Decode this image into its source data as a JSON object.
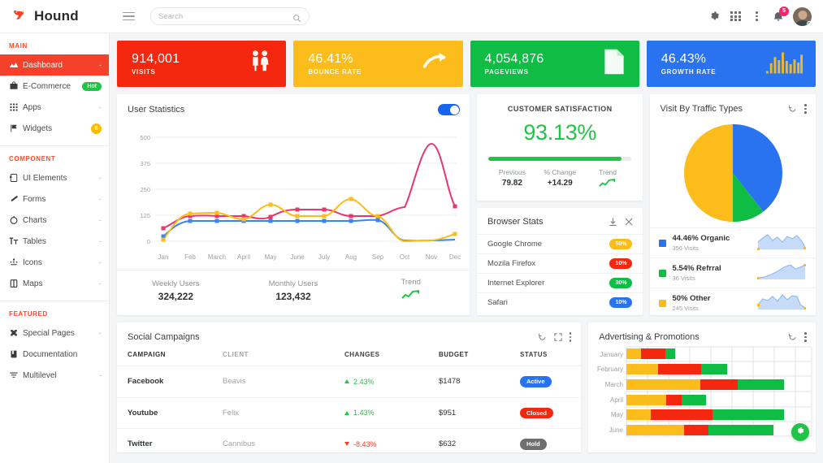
{
  "brand": {
    "name": "Hound",
    "logo_icon": "bird-logo-icon"
  },
  "topbar": {
    "menu_icon": "hamburger-icon",
    "search": {
      "placeholder": "Search",
      "value": "",
      "icon": "search-icon"
    },
    "settings_icon": "gear-icon",
    "apps_icon": "grid-apps-icon",
    "more_icon": "vertical-dots-icon",
    "notifications_icon": "bell-icon",
    "notifications_count": "5",
    "avatar_icon": "user-avatar"
  },
  "sidebar": {
    "sections": [
      {
        "label": "MAIN",
        "items": [
          {
            "label": "Dashboard",
            "icon": "dashboard-icon",
            "active": true,
            "caret": "-"
          },
          {
            "label": "E-Commerce",
            "icon": "basket-icon",
            "badge": "Hot",
            "badge_color": "#21c546",
            "badge_type": "pill"
          },
          {
            "label": "Apps",
            "icon": "apps-grid-icon",
            "caret": "-"
          },
          {
            "label": "Widgets",
            "icon": "flag-icon",
            "badge": "8",
            "badge_color": "#fbbc05",
            "badge_type": "round"
          }
        ]
      },
      {
        "label": "COMPONENT",
        "items": [
          {
            "label": "UI Elements",
            "icon": "ui-elements-icon",
            "caret": "-"
          },
          {
            "label": "Forms",
            "icon": "pencil-icon",
            "caret": "-"
          },
          {
            "label": "Charts",
            "icon": "circle-chart-icon",
            "caret": "-"
          },
          {
            "label": "Tables",
            "icon": "table-text-icon",
            "caret": "-"
          },
          {
            "label": "Icons",
            "icon": "sparkle-icons-icon",
            "caret": "-"
          },
          {
            "label": "Maps",
            "icon": "map-book-icon",
            "caret": "-"
          }
        ]
      },
      {
        "label": "FEATURED",
        "items": [
          {
            "label": "Special Pages",
            "icon": "puzzle-icon",
            "caret": "-"
          },
          {
            "label": "Documentation",
            "icon": "book-icon"
          },
          {
            "label": "Multilevel",
            "icon": "layers-icon",
            "caret": "-"
          }
        ]
      }
    ]
  },
  "stat_cards": [
    {
      "value": "914,001",
      "label": "VISITS",
      "color": "#f4280f",
      "icon": "people-icon"
    },
    {
      "value": "46.41%",
      "label": "BOUNCE RATE",
      "color": "#fcbd1c",
      "icon": "curved-arrow-icon"
    },
    {
      "value": "4,054,876",
      "label": "PAGEVIEWS",
      "color": "#0fbd45",
      "icon": "document-icon"
    },
    {
      "value": "46.43%",
      "label": "GROWTH RATE",
      "color": "#2a73f0",
      "icon": "bar-chart-icon"
    }
  ],
  "user_statistics": {
    "title": "User Statistics",
    "toggle_on": true,
    "footer": [
      {
        "label": "Weekly Users",
        "value": "324,222"
      },
      {
        "label": "Monthly Users",
        "value": "123,432"
      },
      {
        "label": "Trend",
        "value": "",
        "icon": "trend-up-icon"
      }
    ]
  },
  "customer_satisfaction": {
    "title": "CUSTOMER SATISFACTION",
    "value": "93.13%",
    "progress_percent": 93.13,
    "color": "#21c546",
    "stats": [
      {
        "label": "Previous",
        "value": "79.82"
      },
      {
        "label": "% Change",
        "value": "+14.29"
      },
      {
        "label": "Trend",
        "value": "",
        "icon": "trend-up-icon"
      }
    ]
  },
  "browser_stats": {
    "title": "Browser Stats",
    "download_icon": "download-icon",
    "close_icon": "close-icon",
    "rows": [
      {
        "name": "Google Chrome",
        "value": "50%",
        "color": "#fcbd1c"
      },
      {
        "name": "Mozila Firefox",
        "value": "10%",
        "color": "#f4280f"
      },
      {
        "name": "Internet Explorer",
        "value": "30%",
        "color": "#0fbd45"
      },
      {
        "name": "Safari",
        "value": "10%",
        "color": "#2a73f0"
      }
    ]
  },
  "traffic_types": {
    "title": "Visit By Traffic Types",
    "refresh_icon": "refresh-icon",
    "more_icon": "vertical-dots-icon",
    "legend": [
      {
        "label": "44.46% Organic",
        "visits": "356 Visits",
        "color": "#2a73f0"
      },
      {
        "label": "5.54% Refrral",
        "visits": "36 Visits",
        "color": "#0fbd45"
      },
      {
        "label": "50% Other",
        "visits": "245 Visits",
        "color": "#fcbd1c"
      }
    ]
  },
  "social_campaigns": {
    "title": "Social Campaigns",
    "refresh_icon": "refresh-icon",
    "expand_icon": "expand-icon",
    "more_icon": "vertical-dots-icon",
    "columns": [
      "CAMPAIGN",
      "CLIENT",
      "CHANGES",
      "BUDGET",
      "STATUS"
    ],
    "rows": [
      {
        "campaign": "Facebook",
        "client": "Beavis",
        "change": "2.43%",
        "direction": "up",
        "budget": "$1478",
        "status": "Active",
        "status_color": "#2a73f0"
      },
      {
        "campaign": "Youtube",
        "client": "Felix",
        "change": "1.43%",
        "direction": "up",
        "budget": "$951",
        "status": "Closed",
        "status_color": "#f4280f"
      },
      {
        "campaign": "Twitter",
        "client": "Cannibus",
        "change": "-8.43%",
        "direction": "down",
        "budget": "$632",
        "status": "Hold",
        "status_color": "#6f6f6f"
      }
    ]
  },
  "advertising": {
    "title": "Advertising & Promotions",
    "refresh_icon": "refresh-icon",
    "more_icon": "vertical-dots-icon",
    "fab_icon": "settings-gear-icon"
  },
  "chart_data": [
    {
      "type": "line",
      "title": "User Statistics",
      "xlabel": "",
      "ylabel": "",
      "grid": true,
      "legend_position": "none",
      "ylim": [
        0,
        500
      ],
      "yticks": [
        0,
        125,
        250,
        375,
        500
      ],
      "categories": [
        "Jan",
        "Feb",
        "March",
        "April",
        "May",
        "June",
        "July",
        "Aug",
        "Sep",
        "Oct",
        "Nov",
        "Dec"
      ],
      "series": [
        {
          "name": "Series A",
          "color": "#e8366f",
          "values": [
            62,
            102,
            100,
            100,
            98,
            150,
            150,
            120,
            118,
            165,
            470,
            168
          ]
        },
        {
          "name": "Series B",
          "color": "#fcbd1c",
          "values": [
            8,
            112,
            118,
            105,
            170,
            120,
            120,
            190,
            120,
            4,
            8,
            30
          ]
        },
        {
          "name": "Series C",
          "color": "#3a86f0",
          "values": [
            22,
            80,
            80,
            80,
            80,
            80,
            80,
            80,
            84,
            4,
            5,
            8
          ]
        }
      ]
    },
    {
      "type": "pie",
      "title": "Visit By Traffic Types",
      "labels": [
        "Organic",
        "Refrral",
        "Other"
      ],
      "values": [
        44.46,
        5.54,
        50
      ],
      "visits": [
        356,
        36,
        245
      ],
      "colors": [
        "#2a73f0",
        "#0fbd45",
        "#fcbd1c"
      ],
      "legend_position": "bottom"
    },
    {
      "type": "bar",
      "title": "Advertising & Promotions",
      "orientation": "horizontal",
      "stacked": true,
      "grid": true,
      "categories": [
        "January",
        "February",
        "March",
        "April",
        "May",
        "June"
      ],
      "xlim": [
        0,
        100
      ],
      "series": [
        {
          "name": "Yellow",
          "color": "#fcbd1c",
          "values": [
            8,
            17,
            40,
            21,
            13,
            31
          ]
        },
        {
          "name": "Red",
          "color": "#f4280f",
          "values": [
            13,
            23,
            20,
            8,
            33,
            13
          ]
        },
        {
          "name": "Green",
          "color": "#0fbd45",
          "values": [
            5,
            14,
            25,
            13,
            38,
            35
          ]
        }
      ]
    },
    {
      "type": "area",
      "title": "Organic sparkline",
      "values": [
        3,
        5,
        9,
        6,
        8,
        5,
        9,
        7,
        8,
        4
      ],
      "color": "#aac8f5"
    },
    {
      "type": "area",
      "title": "Refrral sparkline",
      "values": [
        1,
        2,
        3,
        5,
        6,
        8,
        9,
        7,
        8,
        9
      ],
      "color": "#aac8f5"
    },
    {
      "type": "area",
      "title": "Other sparkline",
      "values": [
        4,
        7,
        6,
        9,
        7,
        9,
        8,
        9,
        8,
        2
      ],
      "color": "#aac8f5"
    },
    {
      "type": "bar",
      "title": "Growth Rate sparkbars",
      "values": [
        2,
        7,
        8,
        6,
        10,
        6,
        5,
        7,
        5,
        9,
        7
      ],
      "color": "#fcbd1c"
    }
  ]
}
